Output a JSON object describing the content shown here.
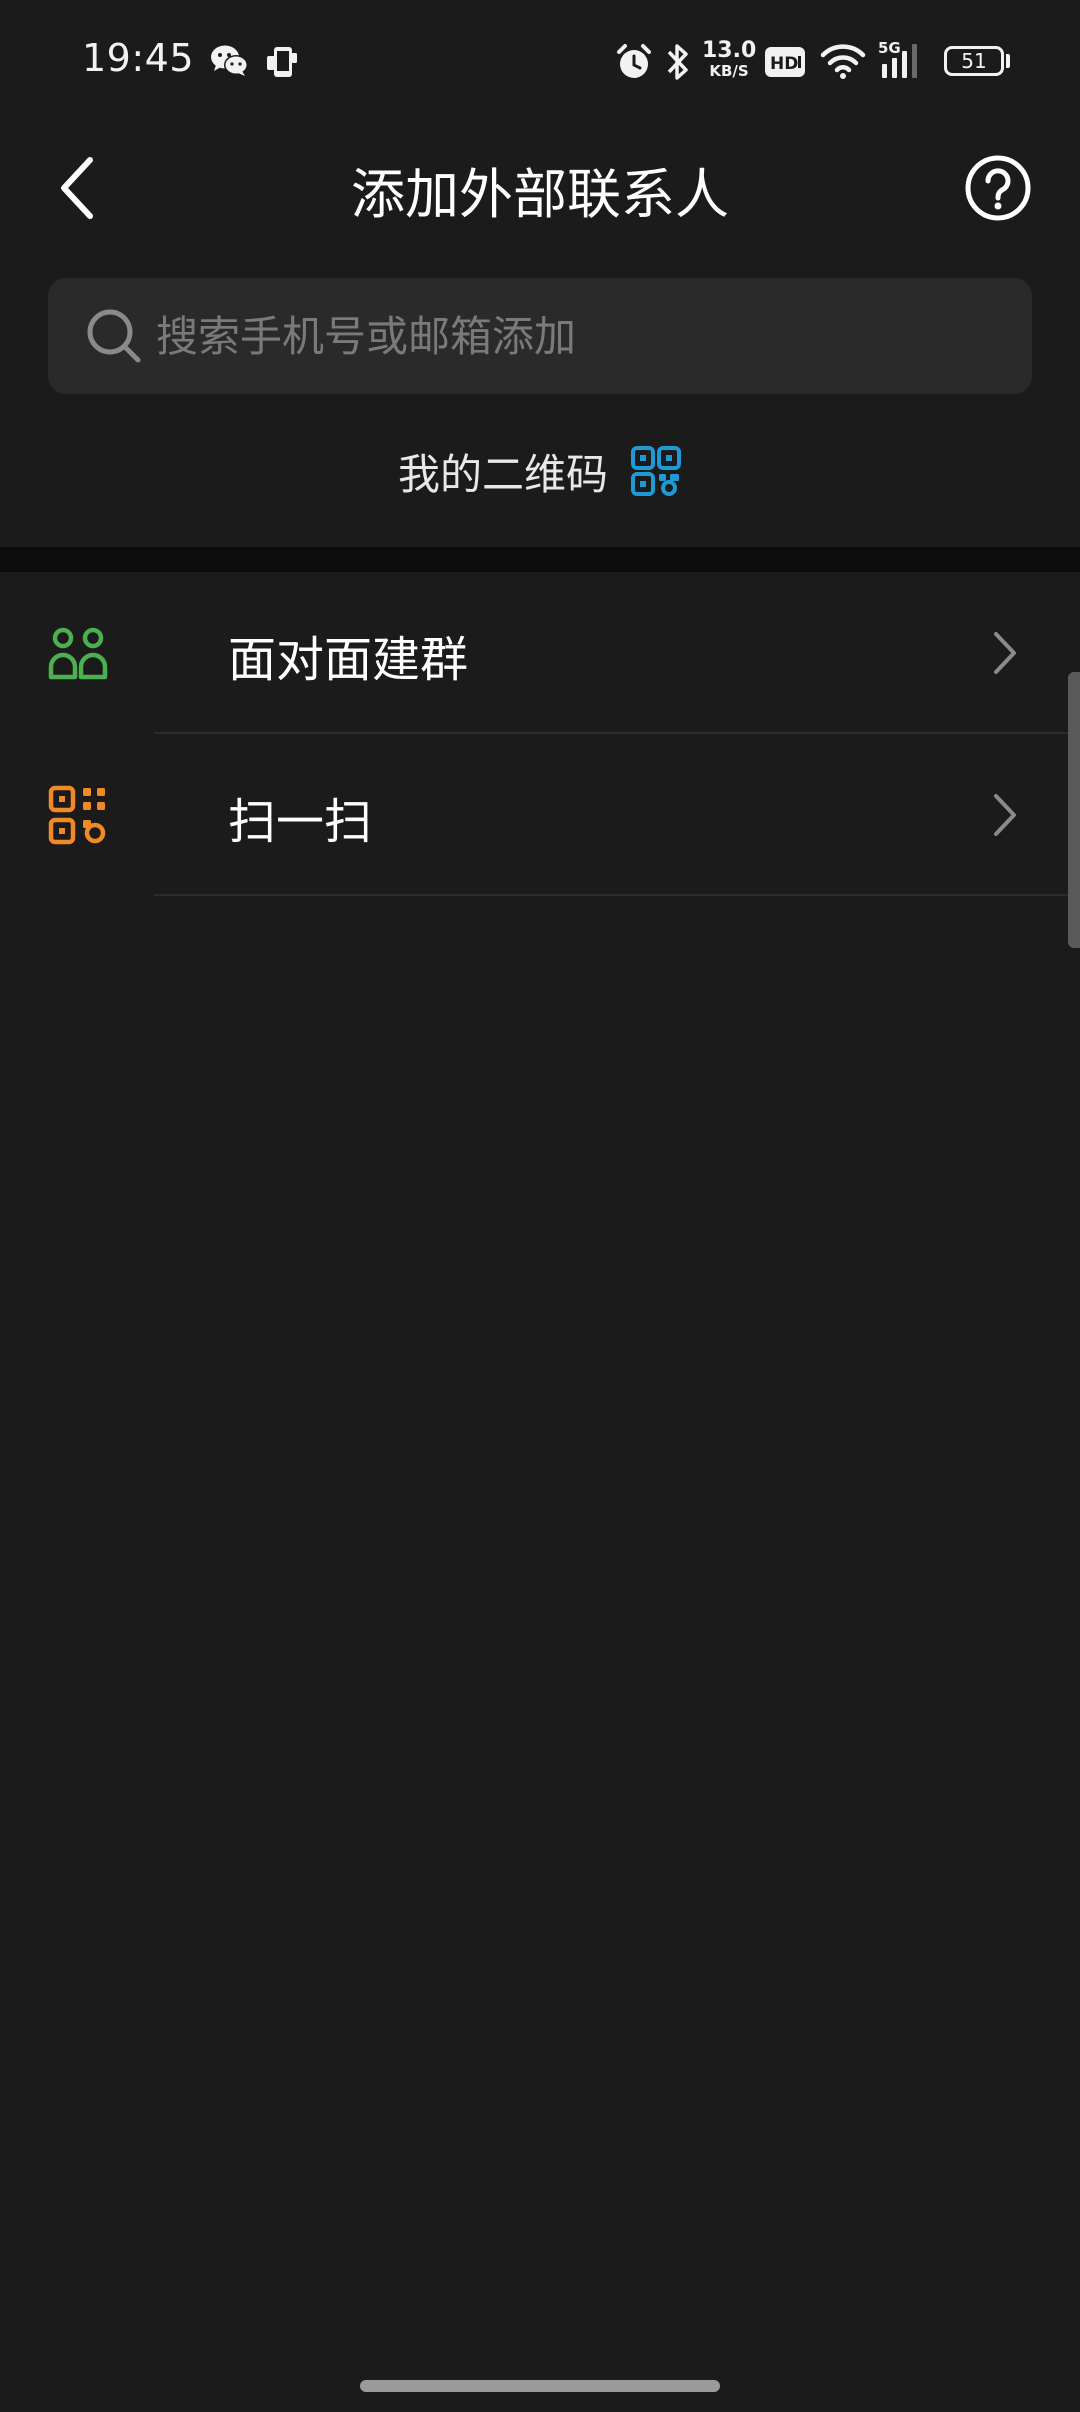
{
  "status_bar": {
    "time": "19:45",
    "net_speed_value": "13.0",
    "net_speed_unit": "KB/S",
    "hd_badge": "HD",
    "network_type": "5G",
    "battery_level": "51",
    "icons": [
      "wechat-icon",
      "phone-sync-icon",
      "alarm-icon",
      "bluetooth-icon",
      "hd-icon",
      "wifi-icon",
      "signal-icon",
      "battery-icon"
    ]
  },
  "header": {
    "title": "添加外部联系人",
    "back_icon": "chevron-left-icon",
    "help_icon": "help-circle-icon"
  },
  "search": {
    "placeholder": "搜索手机号或邮箱添加",
    "value": "",
    "icon": "search-icon"
  },
  "my_qrcode": {
    "label": "我的二维码",
    "icon": "qrcode-icon",
    "icon_color": "#1e9ad6"
  },
  "menu": {
    "items": [
      {
        "label": "面对面建群",
        "icon": "people-group-icon",
        "icon_color": "#4caf50"
      },
      {
        "label": "扫一扫",
        "icon": "scan-qrcode-icon",
        "icon_color": "#f08a24"
      }
    ]
  },
  "colors": {
    "background": "#1b1b1b",
    "search_background": "#2a2a2a",
    "separator": "#0c0c0c"
  }
}
